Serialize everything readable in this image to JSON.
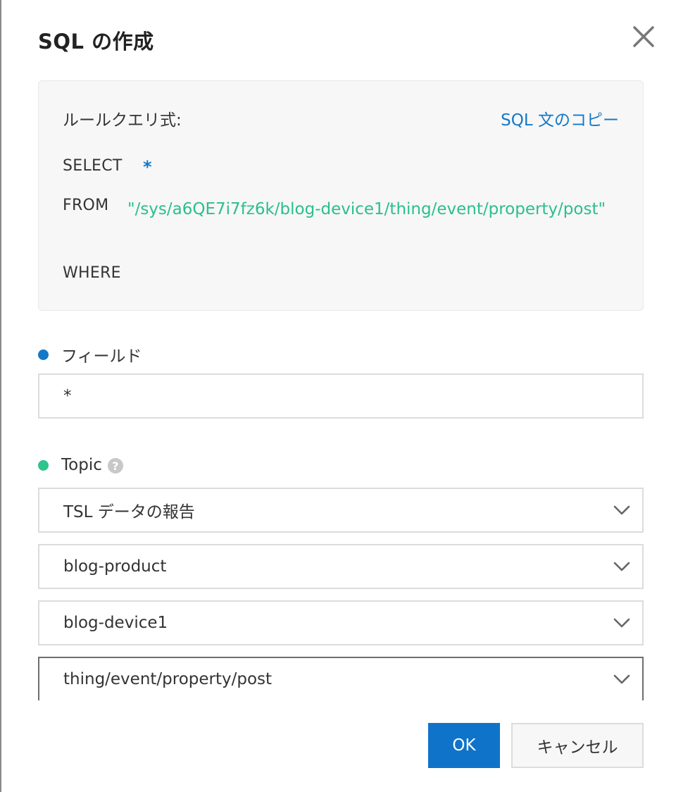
{
  "dialog": {
    "title": "SQL の作成"
  },
  "sql": {
    "label": "ルールクエリ式:",
    "copy_label": "SQL 文のコピー",
    "select_keyword": "SELECT",
    "select_value": "*",
    "from_keyword": "FROM",
    "from_value": "\"/sys/a6QE7i7fz6k/blog-device1/thing/event/property/post\"",
    "where_keyword": "WHERE"
  },
  "field": {
    "label": "フィールド",
    "value": "*"
  },
  "topic": {
    "label": "Topic",
    "help_symbol": "?",
    "selects": [
      "TSL データの報告",
      "blog-product",
      "blog-device1",
      "thing/event/property/post"
    ]
  },
  "buttons": {
    "ok": "OK",
    "cancel": "キャンセル"
  },
  "colors": {
    "accent": "#1478c8",
    "topic_path": "#2bbf8a",
    "ok_button": "#0f73c9"
  },
  "icons": {
    "close": "close-icon",
    "chevron": "chevron-down-icon",
    "help": "help-icon"
  }
}
